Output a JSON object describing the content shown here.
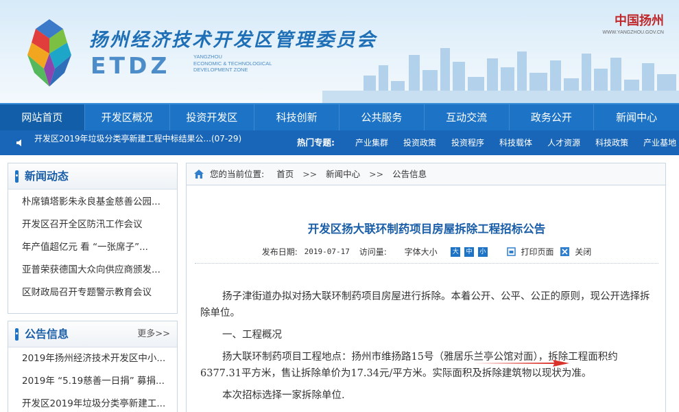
{
  "header": {
    "title_cn": "扬州经济技术开发区管理委员会",
    "logo_text": "ETDZ",
    "logo_en": [
      "YANGZHOU",
      "ECONOMIC & TECHNOLOGICAL",
      "DEVELOPMENT ZONE"
    ],
    "brand_name": "中国扬州",
    "brand_url": "WWW.YANGZHOU.GOV.CN"
  },
  "nav": {
    "items": [
      "网站首页",
      "开发区概况",
      "投资开发区",
      "科技创新",
      "公共服务",
      "互动交流",
      "政务公开",
      "新闻中心"
    ]
  },
  "ticker": {
    "text": "开发区2019年垃圾分类亭新建工程中标结果公...(07-29)",
    "hot_label": "热门专题:",
    "hot_links": [
      "产业集群",
      "投资政策",
      "投资程序",
      "科技载体",
      "人才资源",
      "科技政策",
      "产业基地"
    ]
  },
  "news_box": {
    "title": "新闻动态",
    "items": [
      "朴席镇塔影朱永良基金慈善公园...",
      "开发区召开全区防汛工作会议",
      "年产值超亿元 看 “一张席子”...",
      "亚普荣获德国大众向供应商颁发...",
      "区财政局召开专题警示教育会议"
    ]
  },
  "notice_box": {
    "title": "公告信息",
    "more": "更多>>",
    "items": [
      "2019年扬州经济技术开发区中小...",
      "2019年 “5.19慈善一日捐” 募捐...",
      "开发区2019年垃圾分类亭新建工..."
    ]
  },
  "breadcrumb": {
    "prefix": "您的当前位置:",
    "items": [
      "首页",
      "新闻中心",
      "公告信息"
    ],
    "sep": ">>"
  },
  "article": {
    "title": "开发区扬大联环制药项目房屋拆除工程招标公告",
    "date_label": "发布日期:",
    "date": "2019-07-17",
    "views_label": "访问量:",
    "font_size_label": "字体大小",
    "font_sizes": [
      "大",
      "中",
      "小"
    ],
    "print_label": "打印页面",
    "close_label": "关闭",
    "paragraphs": [
      "扬子津街道办拟对扬大联环制药项目房屋进行拆除。本着公开、公平、公正的原则，现公开选择拆除单位。",
      "一、工程概况",
      "扬大联环制药项目工程地点：扬州市维扬路15号（雅居乐兰亭公馆对面），拆除工程面积约6377.31平方米，售让拆除单价为17.34元/平方米。实际面积及拆除建筑物以现状为准。",
      "本次招标选择一家拆除单位."
    ]
  },
  "colors": {
    "nav_blue": "#1d74c6",
    "title_blue": "#1a5ea8",
    "arrow_red": "#d9342b"
  }
}
